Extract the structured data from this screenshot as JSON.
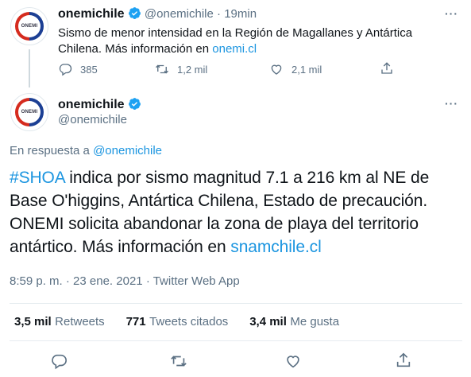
{
  "top_tweet": {
    "avatar_text": "ONEMI",
    "display_name": "onemichile",
    "handle": "@onemichile",
    "separator": "·",
    "time": "19min",
    "more": "···",
    "text_line1": "Sismo de menor intensidad en la Región de Magallanes y Antártica",
    "text_line2_prefix": "Chilena. Más información en ",
    "text_line2_link": "onemi.cl",
    "actions": {
      "reply_count": "385",
      "retweet_count": "1,2 mil",
      "like_count": "2,1 mil"
    }
  },
  "main_tweet": {
    "avatar_text": "ONEMI",
    "display_name": "onemichile",
    "handle": "@onemichile",
    "more": "···",
    "reply_prefix": "En respuesta a ",
    "reply_handle": "@onemichile",
    "hashtag": "#SHOA",
    "text_line1_rest": " indica por sismo magnitud 7.1 a 216 km al NE de",
    "text_line2": "Base O'higgins, Antártica Chilena, Estado de precaución.",
    "text_line3": "ONEMI solicita abandonar la zona de playa del territorio",
    "text_line4_prefix": "antártico. Más información en ",
    "text_line4_link": "snamchile.cl",
    "time": "8:59 p. m.",
    "separator": "·",
    "date": "23 ene. 2021",
    "source": "Twitter Web App",
    "stats": {
      "retweets_num": "3,5 mil",
      "retweets_label": "Retweets",
      "quotes_num": "771",
      "quotes_label": "Tweets citados",
      "likes_num": "3,4 mil",
      "likes_label": "Me gusta"
    }
  },
  "colors": {
    "link": "#1b95e0",
    "verified": "#1da1f2",
    "secondary_text": "#5b7083",
    "divider": "#e6ecf0"
  },
  "icons": [
    "verified-badge-icon",
    "more-icon",
    "reply-icon",
    "retweet-icon",
    "like-icon",
    "share-icon"
  ]
}
